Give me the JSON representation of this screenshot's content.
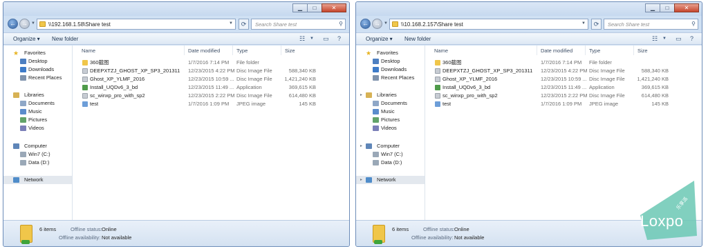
{
  "colors": {
    "accent": "#2d5e9e",
    "frame": "#cfe0f3",
    "folder": "#f0c64a",
    "watermark": "#6bc8b4"
  },
  "windows": [
    {
      "address": "\\\\192.168.1.58\\Share test",
      "search_placeholder": "Search Share test",
      "toolbar": {
        "organize": "Organize ▾",
        "new_folder": "New folder"
      },
      "nav": [
        {
          "label": "Favorites",
          "icon": "star-icon",
          "indent": 0
        },
        {
          "label": "Desktop",
          "icon": "desktop-icon",
          "indent": 1
        },
        {
          "label": "Downloads",
          "icon": "downloads-icon",
          "indent": 1
        },
        {
          "label": "Recent Places",
          "icon": "recent-places-icon",
          "indent": 1
        },
        {
          "label": "Libraries",
          "icon": "libraries-icon",
          "indent": 0
        },
        {
          "label": "Documents",
          "icon": "documents-icon",
          "indent": 1
        },
        {
          "label": "Music",
          "icon": "music-icon",
          "indent": 1
        },
        {
          "label": "Pictures",
          "icon": "pictures-icon",
          "indent": 1
        },
        {
          "label": "Videos",
          "icon": "videos-icon",
          "indent": 1
        },
        {
          "label": "Computer",
          "icon": "computer-icon",
          "indent": 0
        },
        {
          "label": "Win7 (C:)",
          "icon": "drive-icon",
          "indent": 1
        },
        {
          "label": "Data (D:)",
          "icon": "drive-icon",
          "indent": 1
        },
        {
          "label": "Network",
          "icon": "network-icon",
          "indent": 0
        }
      ],
      "columns": {
        "name": "Name",
        "date": "Date modified",
        "type": "Type",
        "size": "Size"
      },
      "files": [
        {
          "name": "360截图",
          "date": "1/7/2016 7:14 PM",
          "type": "File folder",
          "size": "",
          "icon": "folder-icon"
        },
        {
          "name": "DEEPXTZJ_GHOST_XP_SP3_201311",
          "date": "12/23/2015 4:22 PM",
          "type": "Disc Image File",
          "size": "588,340 KB",
          "icon": "disc-image-icon"
        },
        {
          "name": "Ghost_XP_YLMF_2016",
          "date": "12/23/2015 10:59 ...",
          "type": "Disc Image File",
          "size": "1,421,240 KB",
          "icon": "disc-image-icon"
        },
        {
          "name": "Install_UQDv6_3_bd",
          "date": "12/23/2015 11:49 ...",
          "type": "Application",
          "size": "369,615 KB",
          "icon": "application-icon"
        },
        {
          "name": "sc_winxp_pro_with_sp2",
          "date": "12/23/2015 2:22 PM",
          "type": "Disc Image File",
          "size": "614,480 KB",
          "icon": "disc-image-icon"
        },
        {
          "name": "test",
          "date": "1/7/2016 1:09 PM",
          "type": "JPEG image",
          "size": "145 KB",
          "icon": "jpeg-icon"
        }
      ],
      "details": {
        "count": "6 items",
        "status_label": "Offline status:",
        "status_value": "Online",
        "avail_label": "Offline availability:",
        "avail_value": "Not available"
      }
    },
    {
      "address": "\\\\10.168.2.157\\Share test",
      "search_placeholder": "Search Share test",
      "toolbar": {
        "organize": "Organize ▾",
        "new_folder": "New folder"
      },
      "nav": [
        {
          "label": "Favorites",
          "icon": "star-icon",
          "indent": 0
        },
        {
          "label": "Desktop",
          "icon": "desktop-icon",
          "indent": 1
        },
        {
          "label": "Downloads",
          "icon": "downloads-icon",
          "indent": 1
        },
        {
          "label": "Recent Places",
          "icon": "recent-places-icon",
          "indent": 1
        },
        {
          "label": "Libraries",
          "icon": "libraries-icon",
          "indent": 0
        },
        {
          "label": "Documents",
          "icon": "documents-icon",
          "indent": 1
        },
        {
          "label": "Music",
          "icon": "music-icon",
          "indent": 1
        },
        {
          "label": "Pictures",
          "icon": "pictures-icon",
          "indent": 1
        },
        {
          "label": "Videos",
          "icon": "videos-icon",
          "indent": 1
        },
        {
          "label": "Computer",
          "icon": "computer-icon",
          "indent": 0
        },
        {
          "label": "Win7 (C:)",
          "icon": "drive-icon",
          "indent": 1
        },
        {
          "label": "Data (D:)",
          "icon": "drive-icon",
          "indent": 1
        },
        {
          "label": "Network",
          "icon": "network-icon",
          "indent": 0
        }
      ],
      "columns": {
        "name": "Name",
        "date": "Date modified",
        "type": "Type",
        "size": "Size"
      },
      "files": [
        {
          "name": "360截图",
          "date": "1/7/2016 7:14 PM",
          "type": "File folder",
          "size": "",
          "icon": "folder-icon"
        },
        {
          "name": "DEEPXTZJ_GHOST_XP_SP3_201311",
          "date": "12/23/2015 4:22 PM",
          "type": "Disc Image File",
          "size": "588,340 KB",
          "icon": "disc-image-icon"
        },
        {
          "name": "Ghost_XP_YLMF_2016",
          "date": "12/23/2015 10:59 ...",
          "type": "Disc Image File",
          "size": "1,421,240 KB",
          "icon": "disc-image-icon"
        },
        {
          "name": "Install_UQDv6_3_bd",
          "date": "12/23/2015 11:49 ...",
          "type": "Application",
          "size": "369,615 KB",
          "icon": "application-icon"
        },
        {
          "name": "sc_winxp_pro_with_sp2",
          "date": "12/23/2015 2:22 PM",
          "type": "Disc Image File",
          "size": "614,480 KB",
          "icon": "disc-image-icon"
        },
        {
          "name": "test",
          "date": "1/7/2016 1:09 PM",
          "type": "JPEG image",
          "size": "145 KB",
          "icon": "jpeg-icon"
        }
      ],
      "details": {
        "count": "6 items",
        "status_label": "Offline status:",
        "status_value": "Online",
        "avail_label": "Offline availability:",
        "avail_value": "Not available"
      }
    }
  ],
  "watermark": {
    "text": "Loxpo",
    "sub": "乐享派"
  }
}
